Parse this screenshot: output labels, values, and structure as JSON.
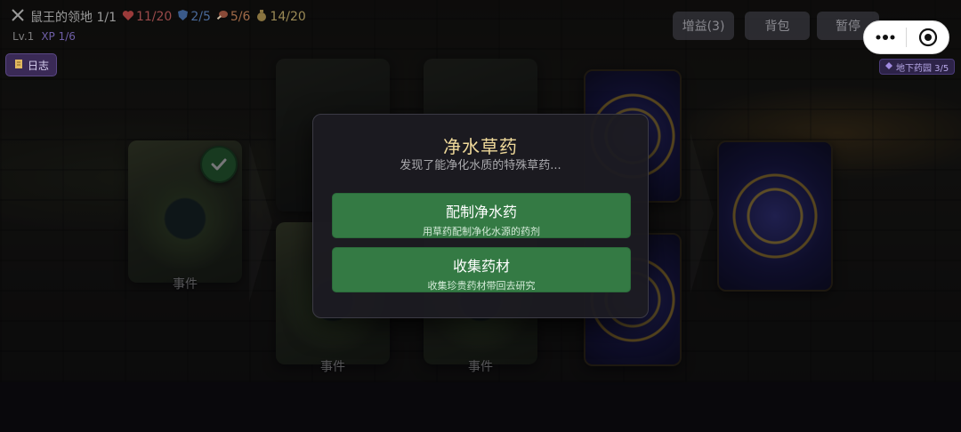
{
  "hud": {
    "location": "鼠王的领地 1/1",
    "hp": "11/20",
    "shield": "2/5",
    "food": "5/6",
    "gold": "14/20",
    "level": "Lv.1",
    "xp": "XP 1/6"
  },
  "log_button": "日志",
  "top_buttons": {
    "buffs": "增益(3)",
    "bag": "背包",
    "pause": "暂停"
  },
  "area_badge": "地下药园  3/5",
  "cards": {
    "labels": [
      "事件",
      "事件",
      "事件"
    ]
  },
  "modal": {
    "title": "净水草药",
    "description": "发现了能净化水质的特殊草药...",
    "choices": [
      {
        "title": "配制净水药",
        "subtitle": "用草药配制净化水源的药剂"
      },
      {
        "title": "收集药材",
        "subtitle": "收集珍贵药材带回去研究"
      }
    ]
  },
  "icons": {
    "location": "crossed-swords-icon",
    "hp": "heart-icon",
    "shield": "shield-icon",
    "food": "meat-icon",
    "gold": "money-bag-icon",
    "log": "scroll-icon",
    "area": "diamond-icon",
    "completed": "checkmark-icon"
  },
  "colors": {
    "choice_button": "#347a44",
    "modal_title": "#efd99a",
    "log_button": "#3a2a56"
  }
}
